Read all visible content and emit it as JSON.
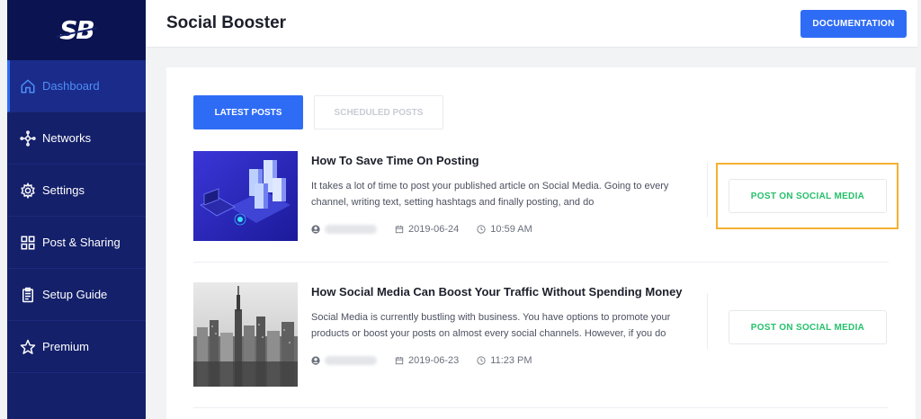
{
  "app": {
    "logo": "SB",
    "title": "Social Booster",
    "documentation_label": "DOCUMENTATION"
  },
  "sidebar": {
    "items": [
      {
        "label": "Dashboard",
        "icon": "home-icon",
        "active": true
      },
      {
        "label": "Networks",
        "icon": "network-icon",
        "active": false
      },
      {
        "label": "Settings",
        "icon": "gear-icon",
        "active": false
      },
      {
        "label": "Post & Sharing",
        "icon": "layout-icon",
        "active": false
      },
      {
        "label": "Setup Guide",
        "icon": "clipboard-icon",
        "active": false
      },
      {
        "label": "Premium",
        "icon": "star-icon",
        "active": false
      }
    ]
  },
  "tabs": [
    {
      "label": "LATEST POSTS",
      "active": true
    },
    {
      "label": "SCHEDULED POSTS",
      "active": false
    }
  ],
  "posts": [
    {
      "title": "How To Save Time On Posting",
      "excerpt": "It takes a lot of time to post your published article on Social Media. Going to every channel, writing text, setting hashtags and finally posting, and do",
      "date": "2019-06-24",
      "time": "10:59 AM",
      "action_label": "POST ON SOCIAL MEDIA"
    },
    {
      "title": "How Social Media Can Boost Your Traffic Without Spending Money",
      "excerpt": "Social Media is currently bustling with business. You have options to promote your products or boost your posts on almost every social channels. However, if you do",
      "date": "2019-06-23",
      "time": "11:23 PM",
      "action_label": "POST ON SOCIAL MEDIA"
    }
  ],
  "colors": {
    "sidebar_bg": "#14206a",
    "accent": "#2f6cf5",
    "action_green": "#24c16b",
    "highlight": "#f5b032"
  }
}
